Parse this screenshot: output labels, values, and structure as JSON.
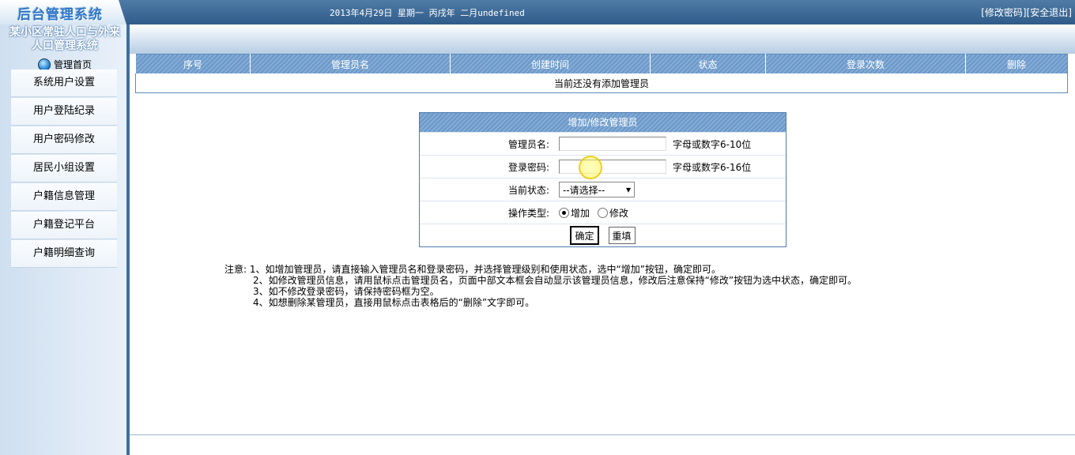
{
  "header": {
    "logo_text": "后台管理系统",
    "date_info": "2013年4月29日 星期一 丙戌年 二月undefined",
    "change_password": "[修改密码]",
    "logout": "[安全退出]"
  },
  "sidebar": {
    "system_title_line1": "某小区常驻人口与外来",
    "system_title_line2": "人口管理系统",
    "home": "管理首页",
    "items": [
      {
        "label": "系统用户设置"
      },
      {
        "label": "用户登陆纪录"
      },
      {
        "label": "用户密码修改"
      },
      {
        "label": "居民小组设置"
      },
      {
        "label": "户籍信息管理"
      },
      {
        "label": "户籍登记平台"
      },
      {
        "label": "户籍明细查询"
      }
    ]
  },
  "admin_table": {
    "columns": [
      "序号",
      "管理员名",
      "创建时间",
      "状态",
      "登录次数",
      "删除"
    ],
    "empty_message": "当前还没有添加管理员"
  },
  "form": {
    "title": "增加/修改管理员",
    "admin_name_label": "管理员名:",
    "admin_name_value": "",
    "admin_name_hint": "字母或数字6-10位",
    "password_label": "登录密码:",
    "password_value": "",
    "password_hint": "字母或数字6-16位",
    "status_label": "当前状态:",
    "status_selected": "--请选择--",
    "op_label": "操作类型:",
    "op_add": "增加",
    "op_modify": "修改",
    "op_selected": "增加",
    "confirm": "确定",
    "reset": "重填"
  },
  "notes": {
    "prefix": "注意:",
    "lines": [
      "1、如增加管理员，请直接输入管理员名和登录密码，并选择管理级别和使用状态，选中“增加”按钮，确定即可。",
      "2、如修改管理员信息，请用鼠标点击管理员名，页面中部文本框会自动显示该管理员信息，修改后注意保持“修改”按钮为选中状态，确定即可。",
      "3、如不修改登录密码，请保持密码框为空。",
      "4、如想删除某管理员，直接用鼠标点击表格后的“删除”文字即可。"
    ]
  }
}
